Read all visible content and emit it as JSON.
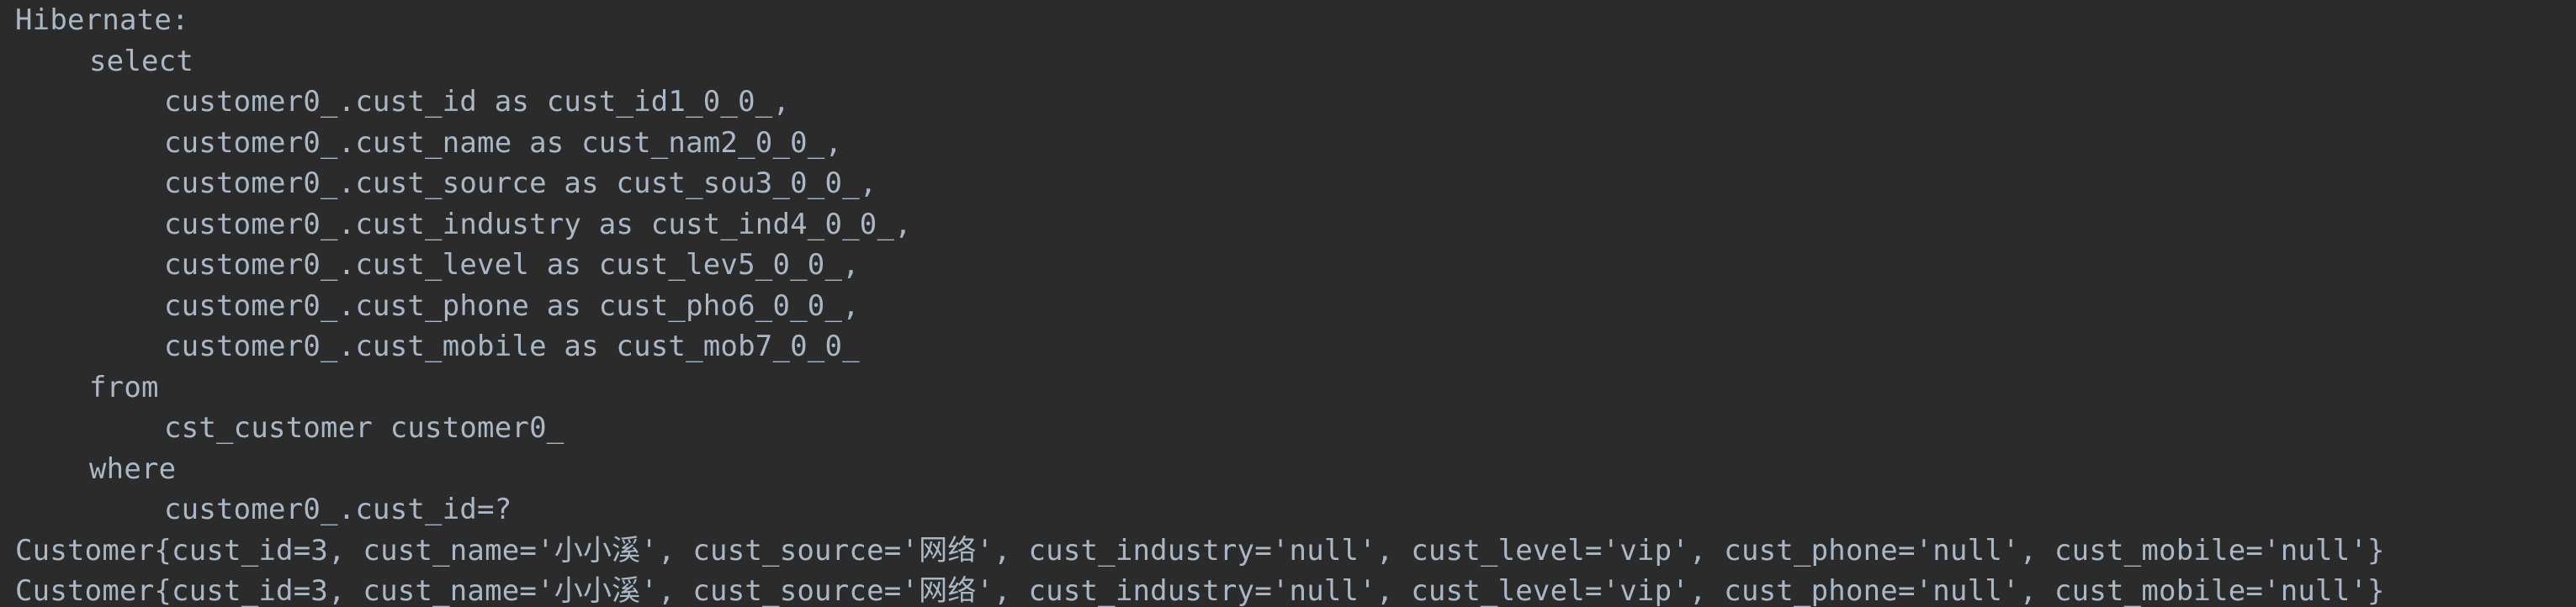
{
  "console": {
    "lines": [
      {
        "indent": 0,
        "text": "Hibernate:"
      },
      {
        "indent": 1,
        "text": "select"
      },
      {
        "indent": 2,
        "text": "customer0_.cust_id as cust_id1_0_0_,"
      },
      {
        "indent": 2,
        "text": "customer0_.cust_name as cust_nam2_0_0_,"
      },
      {
        "indent": 2,
        "text": "customer0_.cust_source as cust_sou3_0_0_,"
      },
      {
        "indent": 2,
        "text": "customer0_.cust_industry as cust_ind4_0_0_,"
      },
      {
        "indent": 2,
        "text": "customer0_.cust_level as cust_lev5_0_0_,"
      },
      {
        "indent": 2,
        "text": "customer0_.cust_phone as cust_pho6_0_0_,"
      },
      {
        "indent": 2,
        "text": "customer0_.cust_mobile as cust_mob7_0_0_"
      },
      {
        "indent": 1,
        "text": "from"
      },
      {
        "indent": 2,
        "text": "cst_customer customer0_"
      },
      {
        "indent": 1,
        "text": "where"
      },
      {
        "indent": 2,
        "text": "customer0_.cust_id=?"
      },
      {
        "indent": 0,
        "text": "Customer{cust_id=3, cust_name='小小溪', cust_source='网络', cust_industry='null', cust_level='vip', cust_phone='null', cust_mobile='null'}"
      },
      {
        "indent": 0,
        "text": "Customer{cust_id=3, cust_name='小小溪', cust_source='网络', cust_industry='null', cust_level='vip', cust_phone='null', cust_mobile='null'}"
      }
    ]
  }
}
